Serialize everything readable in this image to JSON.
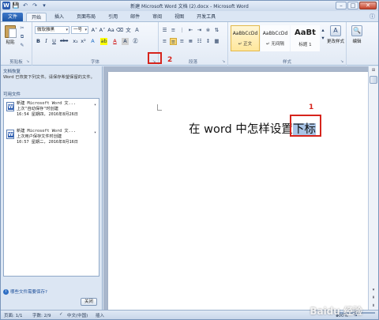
{
  "window": {
    "title": "新建 Microsoft Word 文档 (2).docx - Microsoft Word",
    "word_icon": "W",
    "qat": [
      "save-icon",
      "undo-icon",
      "redo-icon",
      "customize-qat-icon"
    ],
    "controls": [
      "minimize",
      "maximize",
      "close"
    ]
  },
  "tabs": [
    "文件",
    "开始",
    "插入",
    "页面布局",
    "引用",
    "邮件",
    "审阅",
    "视图",
    "开发工具"
  ],
  "ribbon": {
    "clipboard": {
      "paste_label": "粘贴",
      "group_label": "剪贴板"
    },
    "font": {
      "font_name": "微软雅黑",
      "font_size": "一号",
      "group_label": "字体",
      "buttons": [
        "A˄",
        "A˅",
        "Aa",
        "Ａ",
        "B",
        "I",
        "U",
        "abe",
        "x₂",
        "x²",
        "A",
        "A",
        "A"
      ]
    },
    "paragraph": {
      "group_label": "段落"
    },
    "styles": {
      "group_label": "样式",
      "items": [
        {
          "sample": "AaBbCcDd",
          "name": "↵ 正文"
        },
        {
          "sample": "AaBbCcDd",
          "name": "↵ 无间隔"
        },
        {
          "sample": "AaBt",
          "name": "标题 1"
        }
      ],
      "change_styles_label": "更改样式"
    },
    "editing": {
      "label": "编辑"
    }
  },
  "annotations": {
    "marker1": "1",
    "marker2": "2"
  },
  "recovery_pane": {
    "title": "文档恢复",
    "message": "Word 已恢复下列文件。请保存希望保留的文件。",
    "sub_title": "可用文件",
    "files": [
      {
        "name": "新建 Microsoft Word 文...",
        "desc": "上次\"自动保存\"时创建",
        "time": "16:54 星期四, 2016年8月26日"
      },
      {
        "name": "新建 Microsoft Word 文...",
        "desc": "上次用户保存文件时创建",
        "time": "10:57 星期二, 2016年8月16日"
      }
    ],
    "link": "哪些文件需要保存?",
    "close_label": "关闭"
  },
  "document": {
    "text_before": "在 word 中怎样设置",
    "text_selected": "下标"
  },
  "status": {
    "page": "页面: 1/1",
    "words": "字数: 2/9",
    "language": "中文(中国)",
    "mode": "插入",
    "zoom": "100%"
  },
  "watermark": "Baidu 经验"
}
